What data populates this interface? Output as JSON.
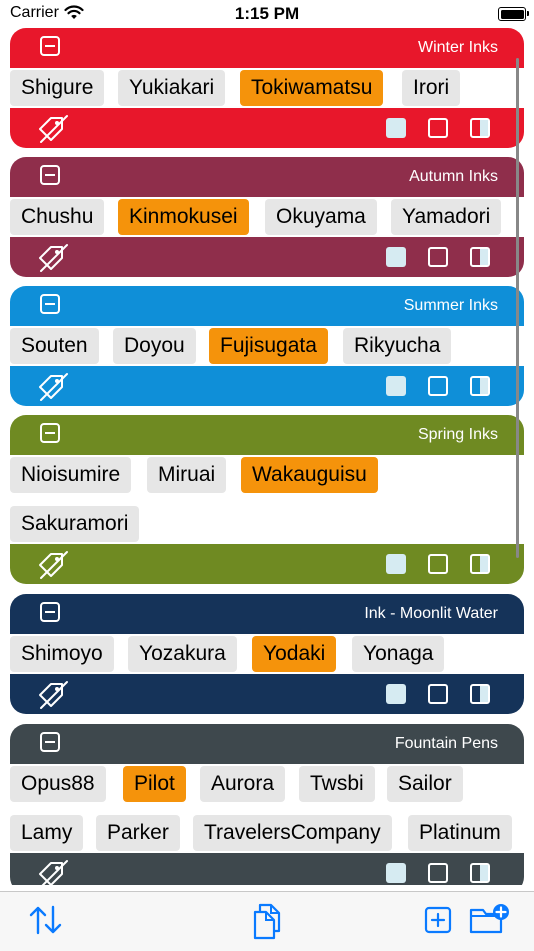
{
  "status_bar": {
    "carrier": "Carrier",
    "time": "1:15 PM"
  },
  "groups": [
    {
      "title": "Winter Inks",
      "color": "#e8172b",
      "chips": [
        {
          "label": "Shigure",
          "selected": false
        },
        {
          "label": "Yukiakari",
          "selected": false
        },
        {
          "label": "Tokiwamatsu",
          "selected": true
        },
        {
          "label": "Irori",
          "selected": false
        }
      ]
    },
    {
      "title": "Autumn Inks",
      "color": "#8f2e4b",
      "chips": [
        {
          "label": "Chushu",
          "selected": false
        },
        {
          "label": "Kinmokusei",
          "selected": true
        },
        {
          "label": "Okuyama",
          "selected": false
        },
        {
          "label": "Yamadori",
          "selected": false
        }
      ]
    },
    {
      "title": "Summer Inks",
      "color": "#0f8fd8",
      "chips": [
        {
          "label": "Souten",
          "selected": false
        },
        {
          "label": "Doyou",
          "selected": false
        },
        {
          "label": "Fujisugata",
          "selected": true
        },
        {
          "label": "Rikyucha",
          "selected": false
        }
      ]
    },
    {
      "title": "Spring Inks",
      "color": "#6f8a22",
      "chips": [
        {
          "label": "Nioisumire",
          "selected": false
        },
        {
          "label": "Miruai",
          "selected": false
        },
        {
          "label": "Wakauguisu",
          "selected": true
        },
        {
          "label": "Sakuramori",
          "selected": false
        }
      ]
    },
    {
      "title": "Ink - Moonlit Water",
      "color": "#153359",
      "chips": [
        {
          "label": "Shimoyo",
          "selected": false
        },
        {
          "label": "Yozakura",
          "selected": false
        },
        {
          "label": "Yodaki",
          "selected": true
        },
        {
          "label": "Yonaga",
          "selected": false
        }
      ]
    },
    {
      "title": "Fountain Pens",
      "color": "#3e484d",
      "chips": [
        {
          "label": "Opus88",
          "selected": false
        },
        {
          "label": "Pilot",
          "selected": true
        },
        {
          "label": "Aurora",
          "selected": false
        },
        {
          "label": "Twsbi",
          "selected": false
        },
        {
          "label": "Sailor",
          "selected": false
        },
        {
          "label": "Lamy",
          "selected": false
        },
        {
          "label": "Parker",
          "selected": false
        },
        {
          "label": "TravelersCompany",
          "selected": false
        },
        {
          "label": "Platinum",
          "selected": false
        }
      ]
    }
  ],
  "group_icons": {
    "collapse": "minus-square-icon",
    "tag": "tag-slash-icon",
    "swatch_filled": "filled-square-icon",
    "swatch_outline": "outline-square-icon",
    "swatch_half": "half-filled-square-icon"
  },
  "toolbar": {
    "sort_icon": "sort-arrows-icon",
    "copy_icon": "copy-documents-icon",
    "add_icon": "plus-square-icon",
    "new_folder_icon": "folder-badge-plus-icon"
  },
  "colors": {
    "selected_chip": "#f5930b",
    "chip": "#e6e6e6",
    "swatch": "#d6ebf2"
  }
}
